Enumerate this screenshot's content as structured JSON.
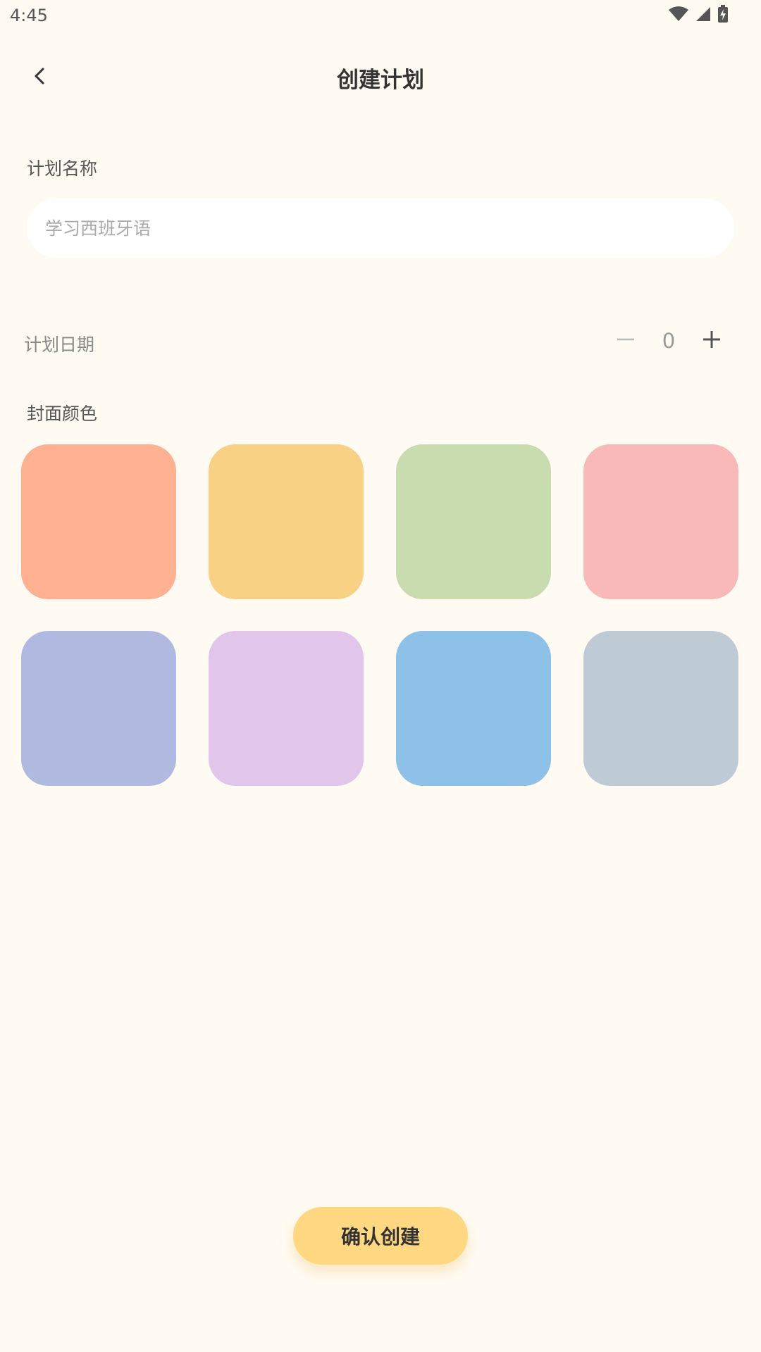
{
  "status_bar": {
    "time": "4:45",
    "icons": [
      "wifi-icon",
      "signal-icon",
      "battery-charging-icon"
    ]
  },
  "app_bar": {
    "title": "创建计划",
    "back_icon": "back-arrow-icon"
  },
  "plan_name": {
    "label": "计划名称",
    "value": "",
    "placeholder": "学习西班牙语"
  },
  "plan_date": {
    "label": "计划日期",
    "value": "0",
    "decrement_icon": "minus-icon",
    "increment_icon": "plus-icon"
  },
  "cover_color": {
    "label": "封面颜色",
    "colors": [
      "#FFB192",
      "#F9D185",
      "#C8DCAF",
      "#F8B9B8",
      "#B0BAE0",
      "#E2C5EB",
      "#8DC1E8",
      "#BECBD5"
    ]
  },
  "actions": {
    "confirm_label": "确认创建"
  },
  "theme": {
    "background": "#FFFBF3",
    "accent": "#FFD881"
  }
}
